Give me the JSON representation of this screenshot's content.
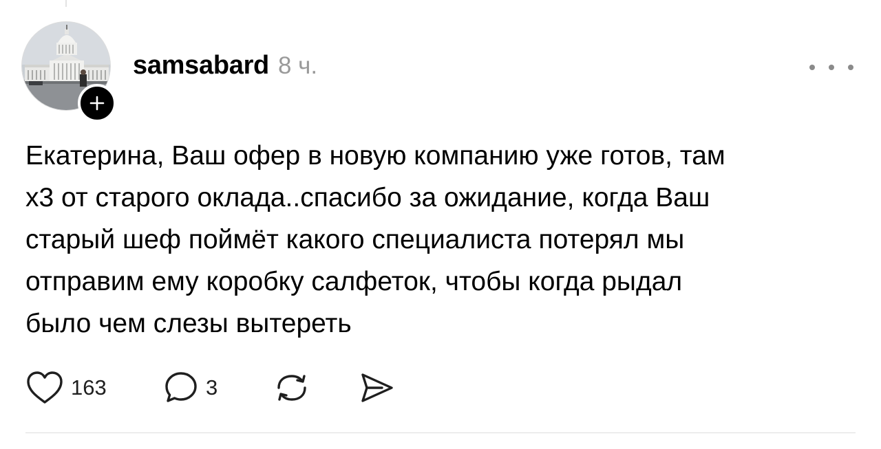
{
  "post": {
    "author": "samsabard",
    "time": "8 ч.",
    "text_lines": [
      "Екатерина, Ваш офер в новую компанию уже готов, там",
      "х3 от старого оклада..спасибо за ожидание, когда Ваш",
      "старый шеф поймёт какого специалиста потерял мы",
      "отправим ему коробку салфеток, чтобы когда рыдал",
      "было чем слезы вытереть"
    ],
    "likes": "163",
    "replies": "3"
  },
  "icons": {
    "follow": "plus-icon",
    "more": "ellipsis-icon",
    "like": "heart-icon",
    "reply": "speech-bubble-icon",
    "repost": "repost-arrows-icon",
    "share": "send-icon"
  },
  "colors": {
    "text": "#000000",
    "muted": "#9a9a9a",
    "divider": "#dddddd"
  }
}
